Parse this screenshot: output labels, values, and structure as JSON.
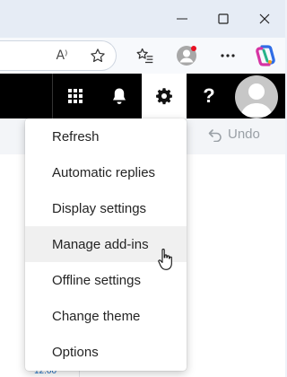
{
  "browser": {
    "window_controls": [
      "minimize",
      "maximize",
      "close"
    ],
    "toolbar_icons": [
      "read-aloud-icon",
      "favorites-star-icon",
      "favorites-list-icon",
      "profile-icon",
      "more-icon",
      "copilot-icon"
    ],
    "read_aloud_glyph": "A⁾"
  },
  "header": {
    "icons": [
      "app-launcher-icon",
      "bell-icon",
      "gear-icon",
      "help-icon",
      "avatar"
    ],
    "help_label": "?",
    "gear_selected": true,
    "profile_badge_color": "#e81123"
  },
  "ribbon": {
    "undo_label": "Undo"
  },
  "menu": {
    "hovered": "Manage add-ins",
    "items": [
      {
        "label": "Refresh"
      },
      {
        "label": "Automatic replies"
      },
      {
        "label": "Display settings"
      },
      {
        "label": "Manage add-ins"
      },
      {
        "label": "Offline settings"
      },
      {
        "label": "Change theme"
      },
      {
        "label": "Options"
      }
    ]
  },
  "background_peek": "12:00"
}
